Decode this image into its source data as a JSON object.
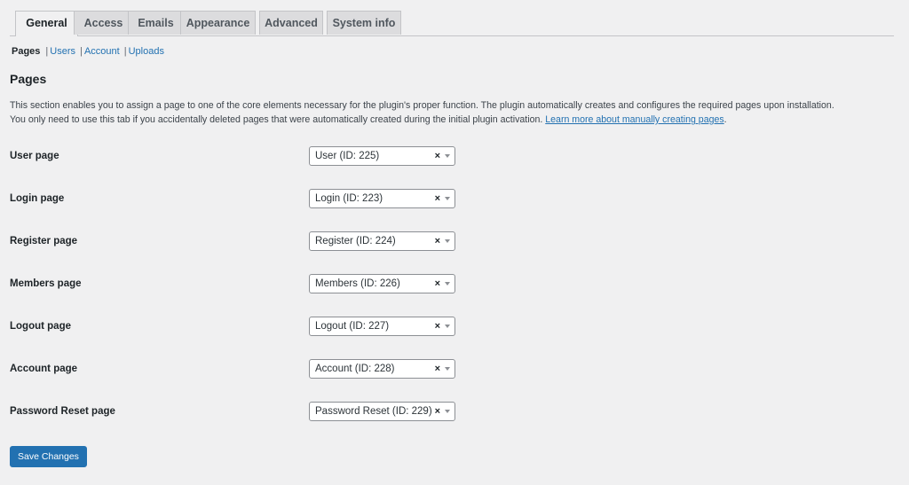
{
  "tabs": [
    {
      "label": "General",
      "active": true
    },
    {
      "label": "Access",
      "active": false
    },
    {
      "label": "Emails",
      "active": false
    },
    {
      "label": "Appearance",
      "active": false
    },
    {
      "label": "Advanced",
      "active": false
    },
    {
      "label": "System info",
      "active": false
    }
  ],
  "subnav": {
    "current": "Pages",
    "separator": "|",
    "links": [
      "Users",
      "Account",
      "Uploads"
    ]
  },
  "section": {
    "title": "Pages",
    "description_line1": "This section enables you to assign a page to one of the core elements necessary for the plugin's proper function. The plugin automatically creates and configures the required pages upon installation.",
    "description_line2": "You only need to use this tab if you accidentally deleted pages that were automatically created during the initial plugin activation.",
    "description_link": "Learn more about manually creating pages",
    "description_end": "."
  },
  "fields": [
    {
      "label": "User page",
      "value": "User (ID: 225)"
    },
    {
      "label": "Login page",
      "value": "Login (ID: 223)"
    },
    {
      "label": "Register page",
      "value": "Register (ID: 224)"
    },
    {
      "label": "Members page",
      "value": "Members (ID: 226)"
    },
    {
      "label": "Logout page",
      "value": "Logout (ID: 227)"
    },
    {
      "label": "Account page",
      "value": "Account (ID: 228)"
    },
    {
      "label": "Password Reset page",
      "value": "Password Reset (ID: 229)"
    }
  ],
  "clear_glyph": "×",
  "save_button": "Save Changes",
  "colors": {
    "background": "#f0f0f1",
    "link": "#2271b1",
    "primary_button": "#2271b1",
    "inactive_tab": "#dcdcde"
  }
}
